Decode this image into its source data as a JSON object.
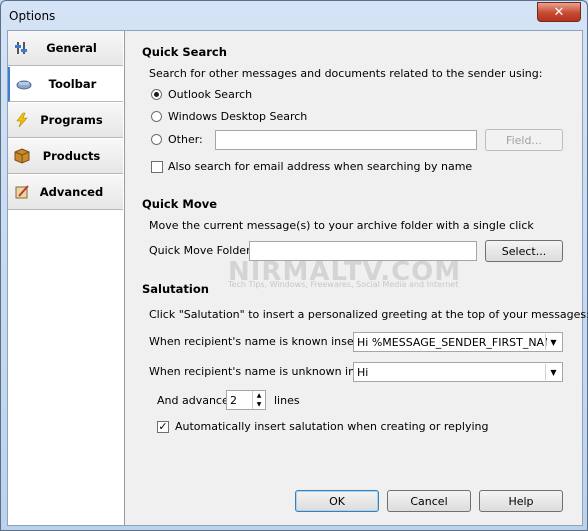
{
  "window": {
    "title": "Options",
    "close_glyph": "✕"
  },
  "sidebar": {
    "items": [
      {
        "label": "General",
        "icon": "general-icon"
      },
      {
        "label": "Toolbar",
        "icon": "toolbar-icon",
        "active": true
      },
      {
        "label": "Programs",
        "icon": "programs-icon"
      },
      {
        "label": "Products",
        "icon": "products-icon"
      },
      {
        "label": "Advanced",
        "icon": "advanced-icon"
      }
    ]
  },
  "quick_search": {
    "heading": "Quick Search",
    "description": "Search for other messages and documents related to the sender using:",
    "options": {
      "outlook": "Outlook Search",
      "windows": "Windows Desktop Search",
      "other": "Other:"
    },
    "selected": "outlook",
    "other_value": "",
    "field_button": "Field...",
    "also_search_label": "Also search for email address when searching by name",
    "also_search_checked": false
  },
  "quick_move": {
    "heading": "Quick Move",
    "description": "Move the current message(s) to your archive folder with a single click",
    "folder_label": "Quick Move Folder:",
    "folder_value": "",
    "select_button": "Select..."
  },
  "salutation": {
    "heading": "Salutation",
    "description": "Click \"Salutation\" to insert a personalized greeting at the top of your messages:",
    "known_label": "When recipient's name is known insert:",
    "known_value": "Hi %MESSAGE_SENDER_FIRST_NAME%,",
    "unknown_label": "When recipient's name is unknown insert:",
    "unknown_value": "Hi",
    "advance_label": "And advance",
    "advance_value": "2",
    "advance_unit": "lines",
    "auto_insert_label": "Automatically insert salutation when creating or replying",
    "auto_insert_checked": true
  },
  "footer": {
    "ok": "OK",
    "cancel": "Cancel",
    "help": "Help"
  },
  "watermark": {
    "text": "NIRMALTV.COM",
    "subtext": "Tech Tips, Windows, Freewares, Social Media and Internet"
  }
}
